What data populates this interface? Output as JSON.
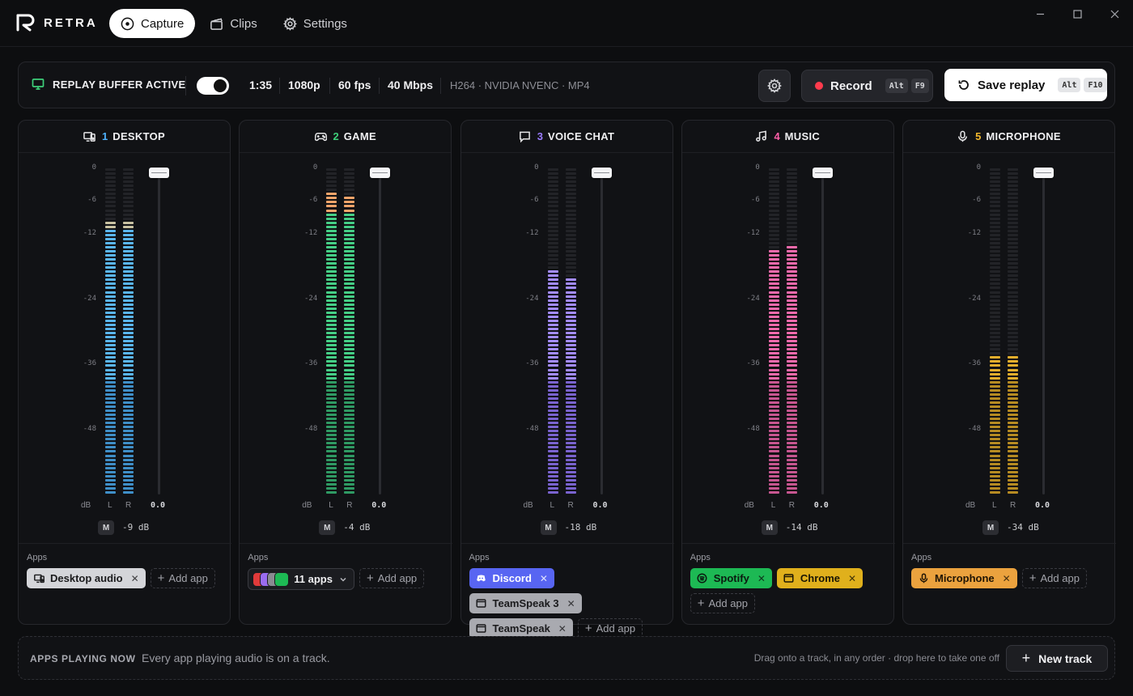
{
  "app": {
    "name": "RETRA"
  },
  "nav": [
    {
      "label": "Capture",
      "icon": "record-circle-icon",
      "active": true
    },
    {
      "label": "Clips",
      "icon": "clapperboard-icon",
      "active": false
    },
    {
      "label": "Settings",
      "icon": "gear-icon",
      "active": false
    }
  ],
  "window_controls": [
    "minimize",
    "maximize",
    "close"
  ],
  "status": {
    "label": "REPLAY BUFFER ACTIVE",
    "replay_enabled": true,
    "duration": "1:35",
    "resolution": "1080p",
    "fps": "60 fps",
    "bitrate": "40 Mbps",
    "codec": "H264 · NVIDIA NVENC · MP4"
  },
  "record": {
    "label": "Record",
    "keys": [
      "Alt",
      "F9"
    ]
  },
  "save_replay": {
    "label": "Save replay",
    "keys": [
      "Alt",
      "F10"
    ]
  },
  "scale": [
    "0",
    "-6",
    "-12",
    "-24",
    "-36",
    "-48"
  ],
  "meter_labels": {
    "db": "dB",
    "left": "L",
    "right": "R",
    "mute": "M"
  },
  "apps_label": "Apps",
  "add_app_label": "Add app",
  "tracks": [
    {
      "number": "1",
      "name": "DESKTOP",
      "icon": "desktop-speaker-icon",
      "accent": "#4fb3ff",
      "colors": {
        "low": "#3f8fc8",
        "mid": "#5ab6ef",
        "high": "#c9c2a2"
      },
      "level": {
        "left": 0.84,
        "right": 0.835
      },
      "fader_value": "0.0",
      "db_value": "-9 dB",
      "apps": [
        {
          "label": "Desktop audio",
          "bg": "#d4d5d9",
          "fg": "#1a1a1c",
          "icon": "desktop-speaker-icon"
        }
      ]
    },
    {
      "number": "2",
      "name": "GAME",
      "icon": "gamepad-icon",
      "accent": "#3ecf7a",
      "colors": {
        "low": "#2f9a63",
        "mid": "#45cf86",
        "high": "#f2a46a"
      },
      "level": {
        "left": 0.92,
        "right": 0.91
      },
      "fader_value": "0.0",
      "db_value": "-4 dB",
      "apps_group": {
        "label": "11 apps",
        "icons": [
          "#e03a3a",
          "#9a6cf0",
          "#8a8b92",
          "#1db954"
        ]
      }
    },
    {
      "number": "3",
      "name": "VOICE CHAT",
      "icon": "chat-bubble-icon",
      "accent": "#9b7cff",
      "colors": {
        "low": "#7a63cf",
        "mid": "#a48cff",
        "high": "#a48cff"
      },
      "level": {
        "left": 0.69,
        "right": 0.66
      },
      "fader_value": "0.0",
      "db_value": "-18 dB",
      "apps": [
        {
          "label": "Discord",
          "bg": "#5865f2",
          "fg": "#ffffff",
          "icon": "discord-icon"
        },
        {
          "label": "TeamSpeak 3",
          "bg": "#a9aab0",
          "fg": "#1a1a1c",
          "icon": "window-icon"
        },
        {
          "label": "TeamSpeak",
          "bg": "#a9aab0",
          "fg": "#1a1a1c",
          "icon": "window-icon"
        }
      ]
    },
    {
      "number": "4",
      "name": "MUSIC",
      "icon": "music-note-icon",
      "accent": "#ff5fa8",
      "colors": {
        "low": "#c75690",
        "mid": "#f06aac",
        "high": "#f06aac"
      },
      "level": {
        "left": 0.75,
        "right": 0.76
      },
      "fader_value": "0.0",
      "db_value": "-14 dB",
      "apps": [
        {
          "label": "Spotify",
          "bg": "#1db954",
          "fg": "#0b1a10",
          "icon": "spotify-icon"
        },
        {
          "label": "Chrome",
          "bg": "#e0b01c",
          "fg": "#1a1605",
          "icon": "window-icon"
        }
      ]
    },
    {
      "number": "5",
      "name": "MICROPHONE",
      "icon": "microphone-icon",
      "accent": "#f2b82d",
      "colors": {
        "low": "#b68b22",
        "mid": "#e3ae2c",
        "high": "#e3ae2c"
      },
      "level": {
        "left": 0.43,
        "right": 0.43
      },
      "fader_value": "0.0",
      "db_value": "-34 dB",
      "apps": [
        {
          "label": "Microphone",
          "bg": "#eba23e",
          "fg": "#1f1404",
          "icon": "microphone-icon"
        }
      ]
    }
  ],
  "dropzone": {
    "title": "APPS PLAYING NOW",
    "text": "Every app playing audio is on a track.",
    "hint": "Drag onto a track, in any order · drop here to take one off",
    "button": "New track"
  }
}
